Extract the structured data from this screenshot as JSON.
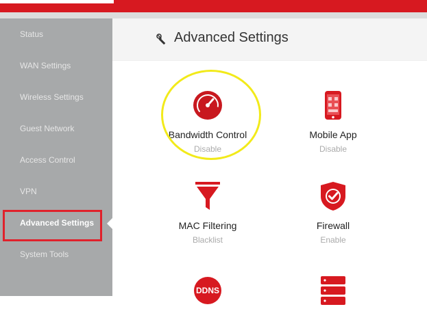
{
  "header": {
    "title": "Advanced Settings"
  },
  "sidebar": {
    "items": [
      {
        "label": "Status"
      },
      {
        "label": "WAN Settings"
      },
      {
        "label": "Wireless Settings"
      },
      {
        "label": "Guest Network"
      },
      {
        "label": "Access Control"
      },
      {
        "label": "VPN"
      },
      {
        "label": "Advanced Settings",
        "active": true
      },
      {
        "label": "System Tools"
      }
    ]
  },
  "tiles": [
    {
      "name": "Bandwidth Control",
      "state": "Disable",
      "icon": "speedometer-icon"
    },
    {
      "name": "Mobile App",
      "state": "Disable",
      "icon": "mobile-app-icon"
    },
    {
      "name": "MAC Filtering",
      "state": "Blacklist",
      "icon": "filter-funnel-icon"
    },
    {
      "name": "Firewall",
      "state": "Enable",
      "icon": "shield-check-icon"
    },
    {
      "name": "DDNS",
      "icon": "ddns-icon"
    },
    {
      "name": "",
      "icon": "server-rack-icon"
    }
  ],
  "colors": {
    "brand_red": "#d71920",
    "sidebar_bg": "#a7a9aa",
    "highlight_yellow": "#f2ea1a",
    "active_box": "#e0212b"
  }
}
